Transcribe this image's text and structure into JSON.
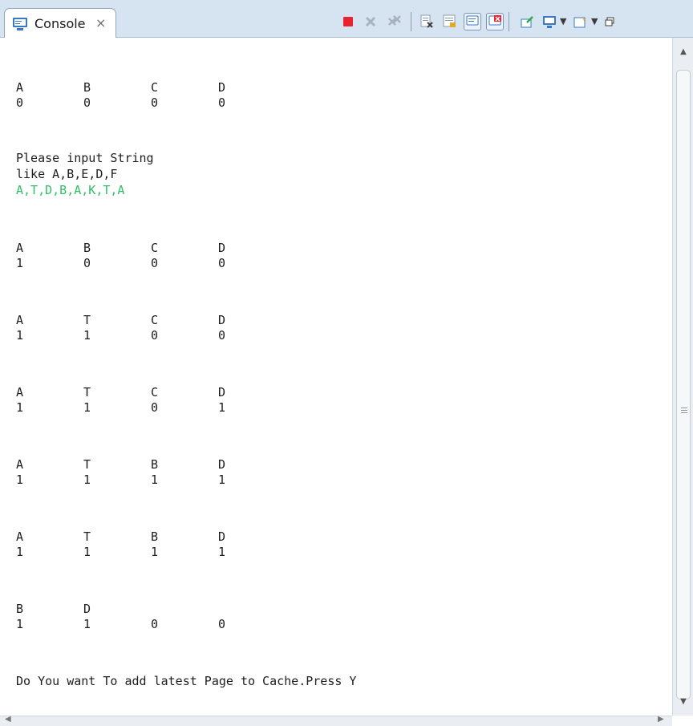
{
  "tab": {
    "label": "Console",
    "close_glyph": "⨯",
    "icon": "console-icon"
  },
  "toolbar": {
    "icons": [
      "terminate-icon",
      "remove-launch-icon",
      "remove-all-terminated-icon",
      "clear-console-icon",
      "scroll-lock-icon",
      "show-on-stdout-icon",
      "show-on-stderr-icon",
      "pin-console-icon",
      "display-console-icon",
      "open-console-icon",
      "minimize-icon"
    ],
    "colors": {
      "terminate": "#e8232f",
      "disabled": "#a9b3bf",
      "accent": "#3a78c3"
    }
  },
  "console": {
    "blocks": [
      {
        "header": [
          "A",
          "B",
          "C",
          "D"
        ],
        "values": [
          "0",
          "0",
          "0",
          "0"
        ]
      },
      {
        "header": [
          "A",
          "B",
          "C",
          "D"
        ],
        "values": [
          "1",
          "0",
          "0",
          "0"
        ]
      },
      {
        "header": [
          "A",
          "T",
          "C",
          "D"
        ],
        "values": [
          "1",
          "1",
          "0",
          "0"
        ]
      },
      {
        "header": [
          "A",
          "T",
          "C",
          "D"
        ],
        "values": [
          "1",
          "1",
          "0",
          "1"
        ]
      },
      {
        "header": [
          "A",
          "T",
          "B",
          "D"
        ],
        "values": [
          "1",
          "1",
          "1",
          "1"
        ]
      },
      {
        "header": [
          "A",
          "T",
          "B",
          "D"
        ],
        "values": [
          "1",
          "1",
          "1",
          "1"
        ]
      },
      {
        "header": [
          "B",
          "D",
          "",
          ""
        ],
        "values": [
          "1",
          "1",
          "0",
          "0"
        ]
      }
    ],
    "prompt_line1": "Please input String",
    "prompt_line2": "like A,B,E,D,F",
    "user_input": "A,T,D,B,A,K,T,A",
    "user_input_color": "#2fbf66",
    "final_prompt": "Do You want To add latest Page to Cache.Press Y"
  }
}
